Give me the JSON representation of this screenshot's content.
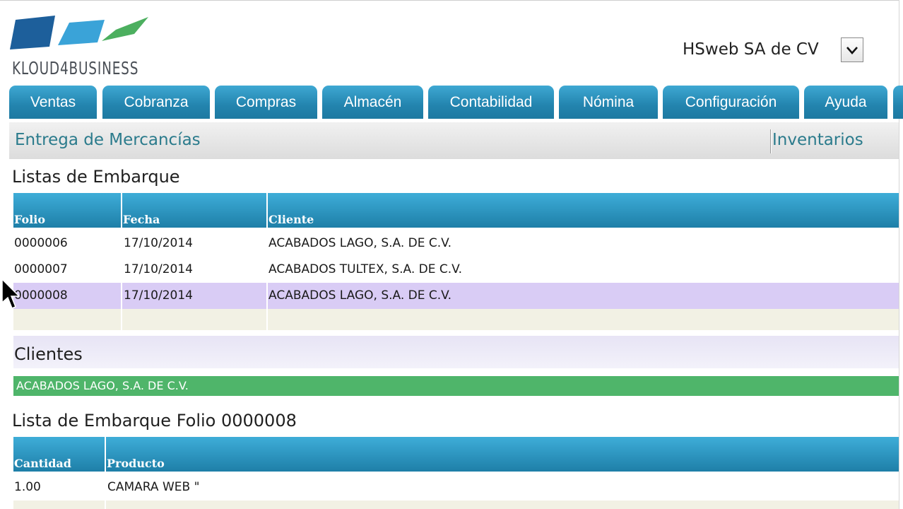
{
  "logo": {
    "text": "KLOUD4BUSINESS"
  },
  "company": {
    "name": "HSweb SA de CV"
  },
  "nav": {
    "tabs": [
      "Ventas",
      "Cobranza",
      "Compras",
      "Almacén",
      "Contabilidad",
      "Nómina",
      "Configuración",
      "Ayuda"
    ]
  },
  "submenu": {
    "left": "Entrega de Mercancías",
    "right": "Inventarios"
  },
  "shipping_lists": {
    "title": "Listas de Embarque",
    "columns": [
      "Folio",
      "Fecha",
      "Cliente"
    ],
    "rows": [
      [
        "0000006",
        "17/10/2014",
        "ACABADOS LAGO, S.A. DE C.V."
      ],
      [
        "0000007",
        "17/10/2014",
        "ACABADOS TULTEX, S.A. DE C.V."
      ],
      [
        "0000008",
        "17/10/2014",
        "ACABADOS LAGO, S.A. DE C.V."
      ]
    ],
    "selected_row": 2
  },
  "clients": {
    "title": "Clientes",
    "selected": "ACABADOS LAGO, S.A. DE C.V."
  },
  "detail": {
    "title": "Lista de Embarque Folio 0000008",
    "columns": [
      "Cantidad",
      "Producto"
    ],
    "rows": [
      [
        "1.00",
        "CAMARA WEB \""
      ]
    ]
  },
  "colors": {
    "tab_blue": "#2384ae",
    "header_blue": "#1e7fa8",
    "link_teal": "#2b7b8c",
    "selected_row": "#d9ccf5",
    "client_green": "#4fb56a"
  },
  "icons": {
    "select": "chevron-down-icon",
    "cursor": "mouse-pointer-icon"
  }
}
